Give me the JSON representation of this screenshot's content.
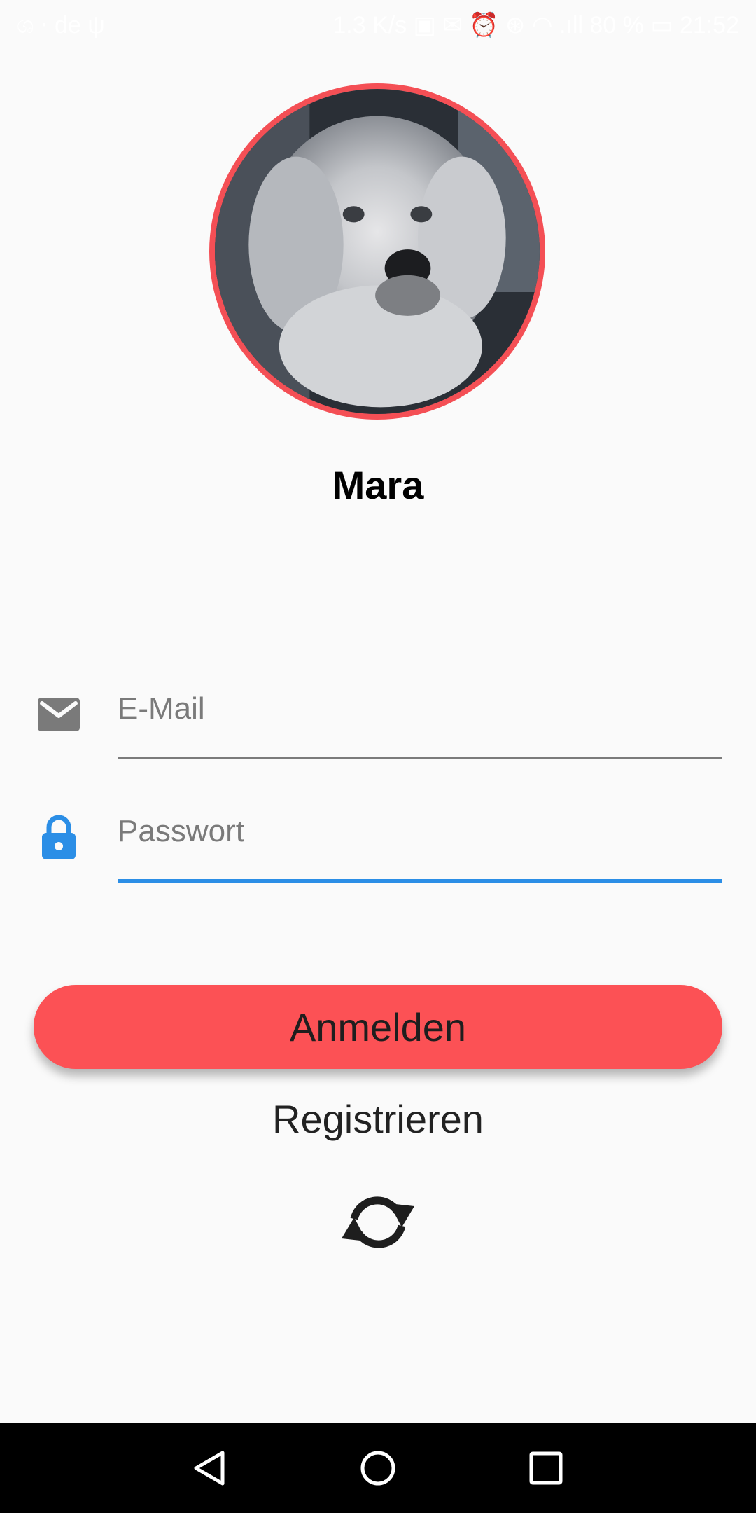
{
  "status_bar": {
    "left_text": "ශ ⋅ de ψ",
    "right_text": "1.3 K/s  ▣ ✉ ⏰ ⊛ ◠ .ıll 80 % ▭ 21:52"
  },
  "profile": {
    "name": "Mara",
    "avatar_description": "dog-photo"
  },
  "form": {
    "email": {
      "placeholder": "E-Mail",
      "value": ""
    },
    "password": {
      "placeholder": "Passwort",
      "value": ""
    }
  },
  "actions": {
    "login_label": "Anmelden",
    "register_label": "Registrieren"
  },
  "colors": {
    "accent": "#fc5155",
    "focus": "#2b8ee6",
    "background": "#fafafa"
  },
  "icons": {
    "email": "email-icon",
    "password": "lock-icon",
    "refresh": "refresh-icon",
    "back": "back-icon",
    "home": "home-icon",
    "recents": "recents-icon"
  }
}
